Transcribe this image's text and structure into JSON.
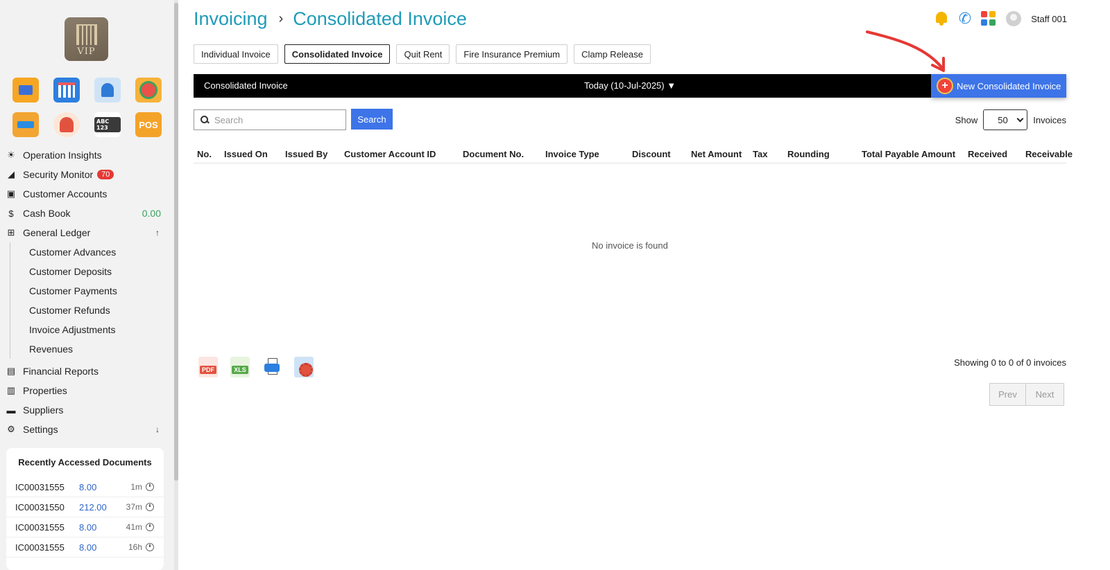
{
  "sidebar": {
    "logo_text": "VIP",
    "app_icons": [
      "staff-card-icon",
      "calendar-icon",
      "bank-icon",
      "tools-icon",
      "access-card-icon",
      "face-id-icon",
      "plate-recognition-icon",
      "pos-icon"
    ],
    "app_icon_texts": {
      "plate": "ABC 123",
      "pos": "POS"
    },
    "nav": [
      {
        "label": "Operation Insights",
        "icon": "lightbulb-icon"
      },
      {
        "label": "Security Monitor",
        "icon": "cctv-icon",
        "badge": "70"
      },
      {
        "label": "Customer Accounts",
        "icon": "account-icon"
      },
      {
        "label": "Cash Book",
        "icon": "dollar-icon",
        "amount": "0.00"
      },
      {
        "label": "General Ledger",
        "icon": "ledger-icon",
        "arrow": "↑"
      }
    ],
    "sub_nav": [
      "Customer Advances",
      "Customer Deposits",
      "Customer Payments",
      "Customer Refunds",
      "Invoice Adjustments",
      "Revenues"
    ],
    "nav_bottom": [
      {
        "label": "Financial Reports",
        "icon": "report-icon"
      },
      {
        "label": "Properties",
        "icon": "building-icon"
      },
      {
        "label": "Suppliers",
        "icon": "truck-icon"
      },
      {
        "label": "Settings",
        "icon": "gear-icon",
        "arrow": "↓"
      }
    ],
    "recent": {
      "title": "Recently Accessed Documents",
      "rows": [
        {
          "doc": "IC00031555",
          "amount": "8.00",
          "age": "1m"
        },
        {
          "doc": "IC00031550",
          "amount": "212.00",
          "age": "37m"
        },
        {
          "doc": "IC00031555",
          "amount": "8.00",
          "age": "41m"
        },
        {
          "doc": "IC00031555",
          "amount": "8.00",
          "age": "16h"
        }
      ]
    }
  },
  "header": {
    "crumb1": "Invoicing",
    "separator": "›",
    "crumb2": "Consolidated Invoice",
    "user": "Staff 001"
  },
  "tabs": [
    "Individual Invoice",
    "Consolidated Invoice",
    "Quit Rent",
    "Fire Insurance Premium",
    "Clamp Release"
  ],
  "active_tab": "Consolidated Invoice",
  "bar": {
    "title": "Consolidated Invoice",
    "date": "Today (10-Jul-2025) ▼",
    "new_button": "New Consolidated Invoice"
  },
  "search": {
    "placeholder": "Search",
    "value": "",
    "button": "Search"
  },
  "show": {
    "label": "Show",
    "value": "50",
    "suffix": "Invoices"
  },
  "table": {
    "columns": [
      "No.",
      "Issued On",
      "Issued By",
      "Customer Account ID",
      "Document No.",
      "Invoice Type",
      "Discount",
      "Net Amount",
      "Tax",
      "Rounding",
      "Total Payable Amount",
      "Received",
      "Receivable"
    ],
    "rows": [],
    "empty_message": "No invoice is found"
  },
  "exports": {
    "pdf": "PDF",
    "xls": "XLS"
  },
  "footer": {
    "showing": "Showing 0 to 0 of 0 invoices",
    "prev": "Prev",
    "next": "Next"
  },
  "colors": {
    "accent": "#3d74e8",
    "title": "#1f9bb8",
    "badge": "#e53935",
    "cash": "#3aa35f"
  }
}
